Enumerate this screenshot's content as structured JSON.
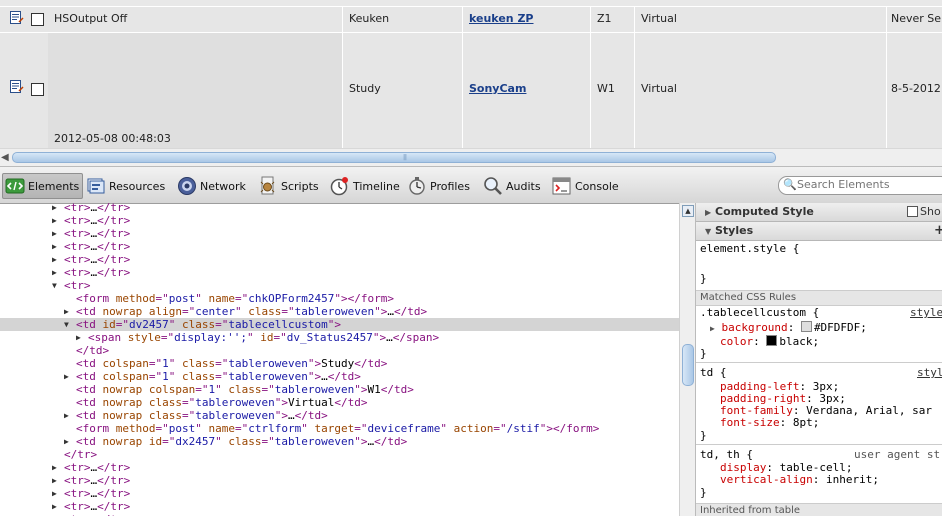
{
  "page": {
    "rows": [
      {
        "name": "HSOutput Off",
        "date": "",
        "room": "Keuken",
        "device": "keuken ZP",
        "code": "Z1",
        "type": "Virtual",
        "last": "Never Se"
      },
      {
        "name": "",
        "date": "2012-05-08 00:48:03",
        "room": "Study",
        "device": "SonyCam",
        "code": "W1",
        "type": "Virtual",
        "last": "8-5-2012"
      }
    ]
  },
  "toolbar": {
    "tabs": [
      "Elements",
      "Resources",
      "Network",
      "Scripts",
      "Timeline",
      "Profiles",
      "Audits",
      "Console"
    ],
    "search_placeholder": "Search Elements"
  },
  "dom_tree": [
    {
      "indent": 0,
      "tri": "right",
      "parts": [
        [
          "tag",
          "<tr>"
        ],
        [
          "tx",
          "…"
        ],
        [
          "tag",
          "</tr>"
        ]
      ],
      "clip": true
    },
    {
      "indent": 0,
      "tri": "right",
      "parts": [
        [
          "tag",
          "<tr>"
        ],
        [
          "tx",
          "…"
        ],
        [
          "tag",
          "</tr>"
        ]
      ]
    },
    {
      "indent": 0,
      "tri": "right",
      "parts": [
        [
          "tag",
          "<tr>"
        ],
        [
          "tx",
          "…"
        ],
        [
          "tag",
          "</tr>"
        ]
      ]
    },
    {
      "indent": 0,
      "tri": "right",
      "parts": [
        [
          "tag",
          "<tr>"
        ],
        [
          "tx",
          "…"
        ],
        [
          "tag",
          "</tr>"
        ]
      ]
    },
    {
      "indent": 0,
      "tri": "right",
      "parts": [
        [
          "tag",
          "<tr>"
        ],
        [
          "tx",
          "…"
        ],
        [
          "tag",
          "</tr>"
        ]
      ]
    },
    {
      "indent": 0,
      "tri": "right",
      "parts": [
        [
          "tag",
          "<tr>"
        ],
        [
          "tx",
          "…"
        ],
        [
          "tag",
          "</tr>"
        ]
      ]
    },
    {
      "indent": 0,
      "tri": "down",
      "parts": [
        [
          "tag",
          "<tr>"
        ]
      ]
    },
    {
      "indent": 1,
      "tri": "",
      "parts": [
        [
          "tag",
          "<form "
        ],
        [
          "an",
          "method"
        ],
        [
          "tag",
          "=\""
        ],
        [
          "av",
          "post"
        ],
        [
          "tag",
          "\" "
        ],
        [
          "an",
          "name"
        ],
        [
          "tag",
          "=\""
        ],
        [
          "av",
          "chkOPForm2457"
        ],
        [
          "tag",
          "\"></form>"
        ]
      ]
    },
    {
      "indent": 1,
      "tri": "right",
      "parts": [
        [
          "tag",
          "<td "
        ],
        [
          "an",
          "nowrap align"
        ],
        [
          "tag",
          "=\""
        ],
        [
          "av",
          "center"
        ],
        [
          "tag",
          "\" "
        ],
        [
          "an",
          "class"
        ],
        [
          "tag",
          "=\""
        ],
        [
          "av",
          "tableroweven"
        ],
        [
          "tag",
          "\">"
        ],
        [
          "tx",
          "…"
        ],
        [
          "tag",
          "</td>"
        ]
      ]
    },
    {
      "indent": 1,
      "tri": "down",
      "sel": true,
      "parts": [
        [
          "tag",
          "<td "
        ],
        [
          "an",
          "id"
        ],
        [
          "tag",
          "=\""
        ],
        [
          "av",
          "dv2457"
        ],
        [
          "tag",
          "\" "
        ],
        [
          "an",
          "class"
        ],
        [
          "tag",
          "=\""
        ],
        [
          "av",
          "tablecellcustom"
        ],
        [
          "tag",
          "\">"
        ]
      ]
    },
    {
      "indent": 2,
      "tri": "right",
      "parts": [
        [
          "tag",
          "<span "
        ],
        [
          "an",
          "style"
        ],
        [
          "tag",
          "=\""
        ],
        [
          "av",
          "display:'';"
        ],
        [
          "tag",
          "\" "
        ],
        [
          "an",
          "id"
        ],
        [
          "tag",
          "=\""
        ],
        [
          "av",
          "dv_Status2457"
        ],
        [
          "tag",
          "\">"
        ],
        [
          "tx",
          "…"
        ],
        [
          "tag",
          "</span>"
        ]
      ]
    },
    {
      "indent": 1,
      "tri": "",
      "parts": [
        [
          "tag",
          "</td>"
        ]
      ]
    },
    {
      "indent": 1,
      "tri": "",
      "parts": [
        [
          "tag",
          "<td "
        ],
        [
          "an",
          "colspan"
        ],
        [
          "tag",
          "=\""
        ],
        [
          "av",
          "1"
        ],
        [
          "tag",
          "\" "
        ],
        [
          "an",
          "class"
        ],
        [
          "tag",
          "=\""
        ],
        [
          "av",
          "tableroweven"
        ],
        [
          "tag",
          "\">"
        ],
        [
          "tx",
          "Study"
        ],
        [
          "tag",
          "</td>"
        ]
      ]
    },
    {
      "indent": 1,
      "tri": "right",
      "parts": [
        [
          "tag",
          "<td "
        ],
        [
          "an",
          "colspan"
        ],
        [
          "tag",
          "=\""
        ],
        [
          "av",
          "1"
        ],
        [
          "tag",
          "\" "
        ],
        [
          "an",
          "class"
        ],
        [
          "tag",
          "=\""
        ],
        [
          "av",
          "tableroweven"
        ],
        [
          "tag",
          "\">"
        ],
        [
          "tx",
          "…"
        ],
        [
          "tag",
          "</td>"
        ]
      ]
    },
    {
      "indent": 1,
      "tri": "",
      "parts": [
        [
          "tag",
          "<td "
        ],
        [
          "an",
          "nowrap colspan"
        ],
        [
          "tag",
          "=\""
        ],
        [
          "av",
          "1"
        ],
        [
          "tag",
          "\" "
        ],
        [
          "an",
          "class"
        ],
        [
          "tag",
          "=\""
        ],
        [
          "av",
          "tableroweven"
        ],
        [
          "tag",
          "\">"
        ],
        [
          "tx",
          "W1"
        ],
        [
          "tag",
          "</td>"
        ]
      ]
    },
    {
      "indent": 1,
      "tri": "",
      "parts": [
        [
          "tag",
          "<td "
        ],
        [
          "an",
          "nowrap class"
        ],
        [
          "tag",
          "=\""
        ],
        [
          "av",
          "tableroweven"
        ],
        [
          "tag",
          "\">"
        ],
        [
          "tx",
          "Virtual"
        ],
        [
          "tag",
          "</td>"
        ]
      ]
    },
    {
      "indent": 1,
      "tri": "right",
      "parts": [
        [
          "tag",
          "<td "
        ],
        [
          "an",
          "nowrap class"
        ],
        [
          "tag",
          "=\""
        ],
        [
          "av",
          "tableroweven"
        ],
        [
          "tag",
          "\">"
        ],
        [
          "tx",
          "…"
        ],
        [
          "tag",
          "</td>"
        ]
      ]
    },
    {
      "indent": 1,
      "tri": "",
      "parts": [
        [
          "tag",
          "<form "
        ],
        [
          "an",
          "method"
        ],
        [
          "tag",
          "=\""
        ],
        [
          "av",
          "post"
        ],
        [
          "tag",
          "\" "
        ],
        [
          "an",
          "name"
        ],
        [
          "tag",
          "=\""
        ],
        [
          "av",
          "ctrlform"
        ],
        [
          "tag",
          "\" "
        ],
        [
          "an",
          "target"
        ],
        [
          "tag",
          "=\""
        ],
        [
          "av",
          "deviceframe"
        ],
        [
          "tag",
          "\" "
        ],
        [
          "an",
          "action"
        ],
        [
          "tag",
          "=\""
        ],
        [
          "av",
          "/stif"
        ],
        [
          "tag",
          "\"></form>"
        ]
      ]
    },
    {
      "indent": 1,
      "tri": "right",
      "parts": [
        [
          "tag",
          "<td "
        ],
        [
          "an",
          "nowrap id"
        ],
        [
          "tag",
          "=\""
        ],
        [
          "av",
          "dx2457"
        ],
        [
          "tag",
          "\" "
        ],
        [
          "an",
          "class"
        ],
        [
          "tag",
          "=\""
        ],
        [
          "av",
          "tableroweven"
        ],
        [
          "tag",
          "\">"
        ],
        [
          "tx",
          "…"
        ],
        [
          "tag",
          "</td>"
        ]
      ]
    },
    {
      "indent": 0,
      "tri": "",
      "parts": [
        [
          "tag",
          "</tr>"
        ]
      ]
    },
    {
      "indent": 0,
      "tri": "right",
      "parts": [
        [
          "tag",
          "<tr>"
        ],
        [
          "tx",
          "…"
        ],
        [
          "tag",
          "</tr>"
        ]
      ]
    },
    {
      "indent": 0,
      "tri": "right",
      "parts": [
        [
          "tag",
          "<tr>"
        ],
        [
          "tx",
          "…"
        ],
        [
          "tag",
          "</tr>"
        ]
      ]
    },
    {
      "indent": 0,
      "tri": "right",
      "parts": [
        [
          "tag",
          "<tr>"
        ],
        [
          "tx",
          "…"
        ],
        [
          "tag",
          "</tr>"
        ]
      ]
    },
    {
      "indent": 0,
      "tri": "right",
      "parts": [
        [
          "tag",
          "<tr>"
        ],
        [
          "tx",
          "…"
        ],
        [
          "tag",
          "</tr>"
        ]
      ]
    },
    {
      "indent": 0,
      "tri": "right",
      "parts": [
        [
          "tag",
          "<tr>"
        ],
        [
          "tx",
          "…"
        ],
        [
          "tag",
          "</tr>"
        ]
      ]
    }
  ],
  "sidebar": {
    "computed_title": "Computed Style",
    "show_label": "Sho",
    "styles_title": "Styles",
    "add_label": "+",
    "element_style": "element.style {",
    "close_brace": "}",
    "matched_title": "Matched CSS Rules",
    "rule1": {
      "selector": ".tablecellcustom {",
      "source": "style",
      "background_prop": "background",
      "background_val": "#DFDFDF;",
      "color_prop": "color",
      "color_val": "black;"
    },
    "rule2": {
      "selector": "td {",
      "source": "styl",
      "decls": [
        {
          "prop": "padding-left",
          "val": "3px;"
        },
        {
          "prop": "padding-right",
          "val": "3px;"
        },
        {
          "prop": "font-family",
          "val": "Verdana, Arial, sar"
        },
        {
          "prop": "font-size",
          "val": "8pt;"
        }
      ]
    },
    "rule3": {
      "selector": "td, th {",
      "source": "user agent st",
      "decls": [
        {
          "prop": "display",
          "val": "table-cell;"
        },
        {
          "prop": "vertical-align",
          "val": "inherit;"
        }
      ]
    },
    "inherited_title": "Inherited from table"
  },
  "colors": {
    "swatch_bg": "#DFDFDF",
    "swatch_color": "#000000"
  }
}
